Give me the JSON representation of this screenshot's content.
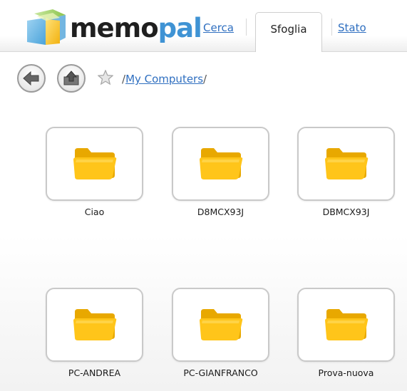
{
  "brand": {
    "name_part1": "memo",
    "name_part2": "pal"
  },
  "nav": {
    "cerca": "Cerca",
    "sfoglia": "Sfoglia",
    "stato": "Stato"
  },
  "toolbar": {
    "back_icon": "back-arrow-icon",
    "up_icon": "upload-arrow-icon",
    "favorite_icon": "star-icon"
  },
  "breadcrumb": {
    "prefix": "/",
    "current": "My Computers",
    "suffix": "/"
  },
  "folders": [
    {
      "label": "Ciao"
    },
    {
      "label": "D8MCX93J"
    },
    {
      "label": "DBMCX93J"
    },
    {
      "label": "PC-ANDREA"
    },
    {
      "label": "PC-GIANFRANCO"
    },
    {
      "label": "Prova-nuova"
    }
  ],
  "colors": {
    "link": "#2f6fc0",
    "brand_blue": "#3f93d4",
    "folder_yellow": "#ffc51a"
  }
}
